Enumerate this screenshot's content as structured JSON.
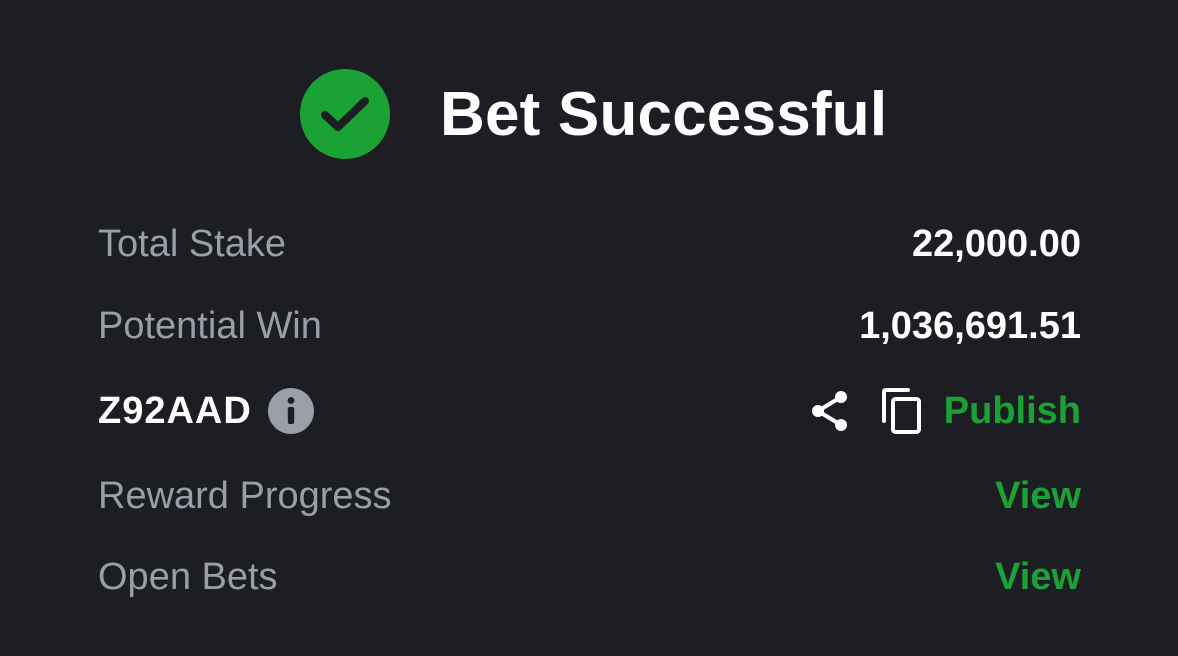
{
  "header": {
    "title": "Bet Successful",
    "icon": "check-circle-icon",
    "icon_color": "#1aa334"
  },
  "summary": {
    "total_stake_label": "Total Stake",
    "total_stake_value": "22,000.00",
    "potential_win_label": "Potential Win",
    "potential_win_value": "1,036,691.51"
  },
  "booking": {
    "code": "Z92AAD",
    "info_icon": "info-icon",
    "share_icon": "share-icon",
    "copy_icon": "copy-icon",
    "publish_label": "Publish"
  },
  "links": {
    "reward_progress_label": "Reward Progress",
    "reward_progress_action": "View",
    "open_bets_label": "Open Bets",
    "open_bets_action": "View"
  },
  "colors": {
    "background": "#1c1e23",
    "accent": "#1aa334",
    "muted_text": "#9a9ea7",
    "text": "#ffffff"
  }
}
